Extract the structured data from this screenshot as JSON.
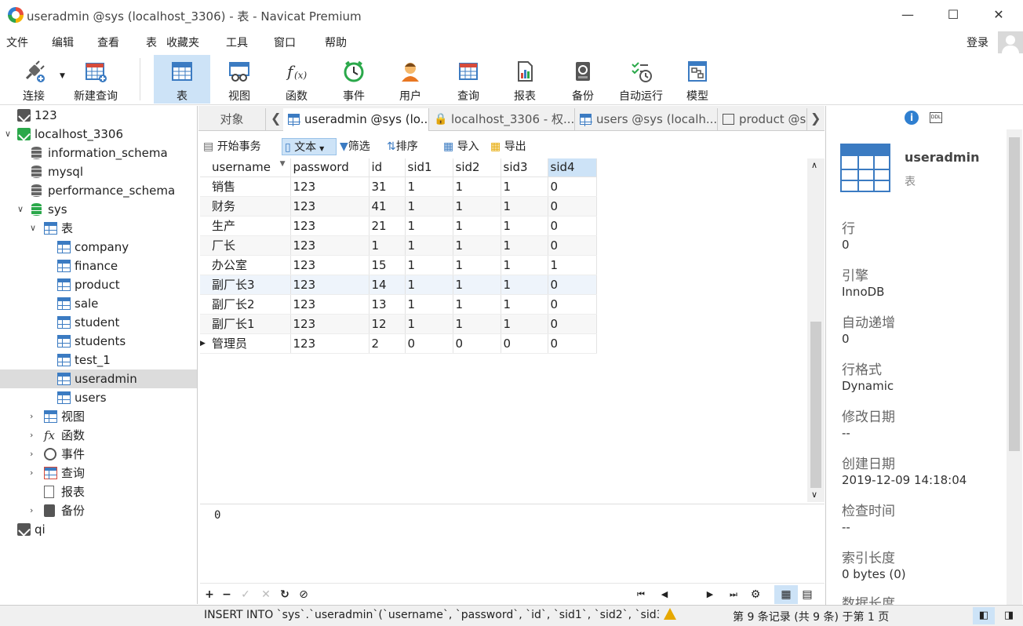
{
  "window": {
    "title": "useradmin @sys (localhost_3306) - 表 - Navicat Premium",
    "min": "—",
    "max": "☐",
    "close": "✕"
  },
  "menu": [
    "文件",
    "编辑",
    "查看",
    "表",
    "收藏夹",
    "工具",
    "窗口",
    "帮助"
  ],
  "login": "登录",
  "toolbar": {
    "connect": "连接",
    "new_query": "新建查询",
    "table": "表",
    "view": "视图",
    "function": "函数",
    "event": "事件",
    "user": "用户",
    "query": "查询",
    "report": "报表",
    "backup": "备份",
    "automation": "自动运行",
    "model": "模型"
  },
  "nav": {
    "conn_123": "123",
    "conn_local": "localhost_3306",
    "db_info": "information_schema",
    "db_mysql": "mysql",
    "db_perf": "performance_schema",
    "db_sys": "sys",
    "tables_group": "表",
    "tables": [
      "company",
      "finance",
      "product",
      "sale",
      "student",
      "students",
      "test_1",
      "useradmin",
      "users"
    ],
    "views": "视图",
    "functions": "函数",
    "events": "事件",
    "queries": "查询",
    "reports": "报表",
    "backups": "备份",
    "conn_qi": "qi"
  },
  "tabs": {
    "objects": "对象",
    "t1": "useradmin @sys (lo...",
    "t2": "localhost_3306 - 权...",
    "t3": "users @sys (localh...",
    "t4": "product @s"
  },
  "gridtools": {
    "begin": "开始事务",
    "text": "文本",
    "filter": "筛选",
    "sort": "排序",
    "import": "导入",
    "export": "导出"
  },
  "columns": [
    "username",
    "password",
    "id",
    "sid1",
    "sid2",
    "sid3",
    "sid4"
  ],
  "rows": [
    [
      "销售",
      "123",
      "31",
      "1",
      "1",
      "1",
      "0"
    ],
    [
      "财务",
      "123",
      "41",
      "1",
      "1",
      "1",
      "0"
    ],
    [
      "生产",
      "123",
      "21",
      "1",
      "1",
      "1",
      "0"
    ],
    [
      "厂长",
      "123",
      "1",
      "1",
      "1",
      "1",
      "0"
    ],
    [
      "办公室",
      "123",
      "15",
      "1",
      "1",
      "1",
      "1"
    ],
    [
      "副厂长3",
      "123",
      "14",
      "1",
      "1",
      "1",
      "0"
    ],
    [
      "副厂长2",
      "123",
      "13",
      "1",
      "1",
      "1",
      "0"
    ],
    [
      "副厂长1",
      "123",
      "12",
      "1",
      "1",
      "1",
      "0"
    ],
    [
      "管理员",
      "123",
      "2",
      "0",
      "0",
      "0",
      "0"
    ]
  ],
  "detail_value": "0",
  "page_number": "1",
  "status": {
    "sql": "INSERT INTO `sys`.`useradmin`(`username`, `password`, `id`, `sid1`, `sid2`, `sid3`, `sid",
    "records": "第 9 条记录 (共 9 条) 于第 1 页"
  },
  "info": {
    "name": "useradmin",
    "type": "表",
    "fields": [
      {
        "label": "行",
        "value": "0"
      },
      {
        "label": "引擎",
        "value": "InnoDB"
      },
      {
        "label": "自动递增",
        "value": "0"
      },
      {
        "label": "行格式",
        "value": "Dynamic"
      },
      {
        "label": "修改日期",
        "value": "--"
      },
      {
        "label": "创建日期",
        "value": "2019-12-09 14:18:04"
      },
      {
        "label": "检查时间",
        "value": "--"
      },
      {
        "label": "索引长度",
        "value": "0 bytes (0)"
      },
      {
        "label": "数据长度",
        "value": ""
      }
    ]
  }
}
